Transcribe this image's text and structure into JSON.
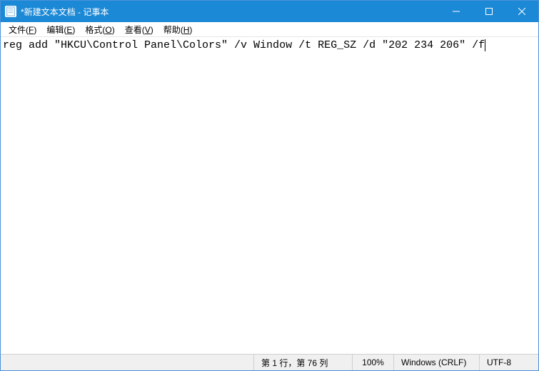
{
  "window": {
    "title": "*新建文本文档 - 记事本"
  },
  "menus": {
    "file": "文件(F)",
    "edit": "编辑(E)",
    "format": "格式(O)",
    "view": "查看(V)",
    "help": "帮助(H)"
  },
  "editor": {
    "content": "reg add \"HKCU\\Control Panel\\Colors\" /v Window /t REG_SZ /d \"202 234 206\" /f"
  },
  "status": {
    "position": "第 1 行，第 76 列",
    "zoom": "100%",
    "eol": "Windows (CRLF)",
    "encoding": "UTF-8"
  }
}
